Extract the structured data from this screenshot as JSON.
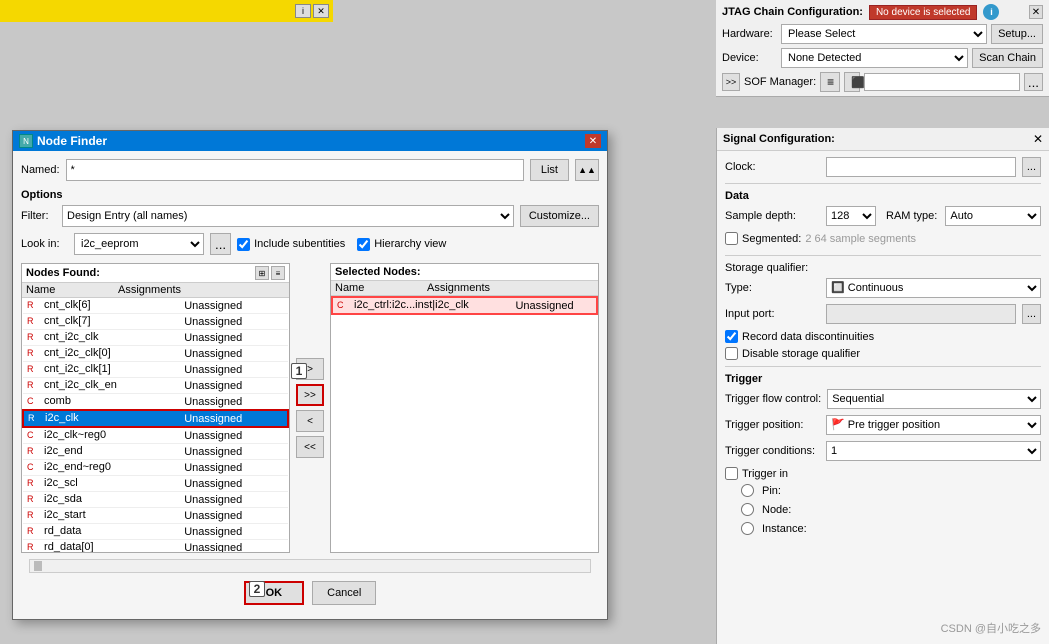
{
  "jtag": {
    "title": "JTAG Chain Configuration:",
    "error_badge": "No device is selected",
    "hardware_label": "Hardware:",
    "hardware_value": "Please Select",
    "device_label": "Device:",
    "device_value": "None Detected",
    "setup_btn": "Setup...",
    "scan_chain_btn": "Scan Chain",
    "sof_label": "SOF Manager:",
    "arrow_label": ">>",
    "info_icon": "i",
    "close_icon": "✕"
  },
  "signal": {
    "title": "Signal Configuration:",
    "close_icon": "✕",
    "clock_label": "Clock:",
    "data_title": "Data",
    "sample_depth_label": "Sample depth:",
    "sample_depth_value": "128",
    "ram_type_label": "RAM type:",
    "ram_type_value": "Auto",
    "segmented_label": "Segmented:",
    "segmented_value": "2  64 sample segments",
    "storage_qualifier_label": "Storage qualifier:",
    "type_label": "Type:",
    "type_value": "Continuous",
    "input_port_label": "Input port:",
    "record_discontinuities": "Record data discontinuities",
    "disable_storage": "Disable storage qualifier",
    "trigger_title": "Trigger",
    "trigger_flow_label": "Trigger flow control:",
    "trigger_flow_value": "Sequential",
    "trigger_pos_label": "Trigger position:",
    "trigger_pos_value": "Pre trigger position",
    "trigger_pos_icon": "🚩",
    "trigger_cond_label": "Trigger conditions:",
    "trigger_cond_value": "1",
    "trigger_in_label": "Trigger in",
    "pin_label": "Pin:",
    "node_label": "Node:",
    "instance_label": "Instance:"
  },
  "node_finder": {
    "title": "Node Finder",
    "named_label": "Named:",
    "named_value": "*",
    "list_btn": "List",
    "options_label": "Options",
    "filter_label": "Filter:",
    "filter_value": "Design Entry (all names)",
    "customize_btn": "Customize...",
    "lookin_label": "Look in:",
    "lookin_value": "i2c_eeprom",
    "include_subentities": "Include subentities",
    "hierarchy_view": "Hierarchy view",
    "nodes_found_title": "Nodes Found:",
    "selected_nodes_title": "Selected Nodes:",
    "nodes_found_headers": [
      "Name",
      "Assignments"
    ],
    "selected_nodes_headers": [
      "Name",
      "Assignments"
    ],
    "nodes_found": [
      {
        "name": "cnt_clk[6]",
        "assignment": "Unassigned",
        "icon": "R"
      },
      {
        "name": "cnt_clk[7]",
        "assignment": "Unassigned",
        "icon": "R"
      },
      {
        "name": "cnt_i2c_clk",
        "assignment": "Unassigned",
        "icon": "R"
      },
      {
        "name": "cnt_i2c_clk[0]",
        "assignment": "Unassigned",
        "icon": "R"
      },
      {
        "name": "cnt_i2c_clk[1]",
        "assignment": "Unassigned",
        "icon": "R"
      },
      {
        "name": "cnt_i2c_clk_en",
        "assignment": "Unassigned",
        "icon": "R"
      },
      {
        "name": "comb",
        "assignment": "Unassigned",
        "icon": "C"
      },
      {
        "name": "i2c_clk",
        "assignment": "Unassigned",
        "icon": "R",
        "selected": true
      },
      {
        "name": "i2c_clk~reg0",
        "assignment": "Unassigned",
        "icon": "C"
      },
      {
        "name": "i2c_end",
        "assignment": "Unassigned",
        "icon": "R"
      },
      {
        "name": "i2c_end~reg0",
        "assignment": "Unassigned",
        "icon": "C"
      },
      {
        "name": "i2c_scl",
        "assignment": "Unassigned",
        "icon": "R"
      },
      {
        "name": "i2c_sda",
        "assignment": "Unassigned",
        "icon": "R"
      },
      {
        "name": "i2c_start",
        "assignment": "Unassigned",
        "icon": "R"
      },
      {
        "name": "rd_data",
        "assignment": "Unassigned",
        "icon": "R"
      },
      {
        "name": "rd_data[0]",
        "assignment": "Unassigned",
        "icon": "R"
      }
    ],
    "selected_nodes": [
      {
        "name": "i2c_ctrl:i2c...inst|i2c_clk",
        "assignment": "Unassigned",
        "icon": "C",
        "highlighted": true
      }
    ],
    "transfer_btns": [
      ">",
      ">>",
      "<",
      "<<"
    ],
    "ok_btn": "OK",
    "cancel_btn": "Cancel",
    "step1": "1",
    "step2": "2"
  }
}
